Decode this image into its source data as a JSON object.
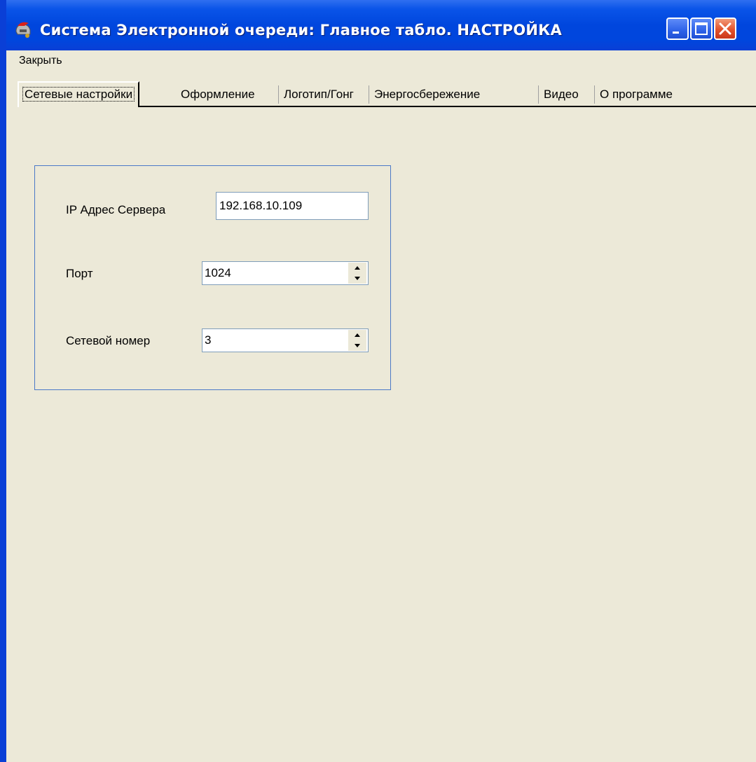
{
  "window": {
    "title": "Система  Электронной очереди: Главное табло. НАСТРОЙКА",
    "icon": "helmet-icon",
    "controls": {
      "minimize": "minimize-icon",
      "maximize": "maximize-icon",
      "close": "close-icon"
    }
  },
  "menu": {
    "items": [
      {
        "label": "Закрыть"
      }
    ]
  },
  "tabs": [
    {
      "label": "Сетевые настройки",
      "active": true
    },
    {
      "label": "Оформление",
      "active": false
    },
    {
      "label": "Логотип/Гонг",
      "active": false
    },
    {
      "label": "Энергосбережение",
      "active": false
    },
    {
      "label": "Видео",
      "active": false
    },
    {
      "label": "О программе",
      "active": false
    }
  ],
  "network": {
    "server_ip": {
      "label": "IP Адрес Сервера",
      "value": "192.168.10.109"
    },
    "port": {
      "label": "Порт",
      "value": "1024"
    },
    "network_number": {
      "label": "Сетевой номер",
      "value": "3"
    }
  },
  "colors": {
    "titlebar": "#0046DD",
    "window_bg": "#ECE9D8",
    "groupbox_border": "#4B79C7",
    "close_button": "#E2522B"
  }
}
